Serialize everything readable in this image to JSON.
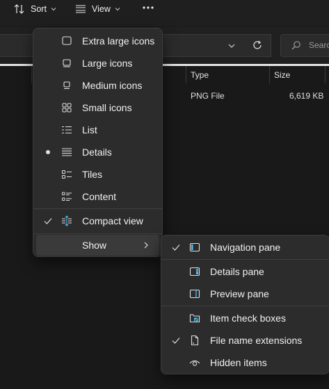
{
  "toolbar": {
    "sort_label": "Sort",
    "view_label": "View"
  },
  "address": {
    "search_placeholder": "Search"
  },
  "columns": [
    {
      "label": ""
    },
    {
      "label": ""
    },
    {
      "label": "Type"
    },
    {
      "label": "Size"
    }
  ],
  "file_row": {
    "type": "PNG File",
    "size": "6,619 KB"
  },
  "view_menu": {
    "items": [
      {
        "label": "Extra large icons",
        "icon": "extra-large-icons-icon"
      },
      {
        "label": "Large icons",
        "icon": "large-icons-icon"
      },
      {
        "label": "Medium icons",
        "icon": "medium-icons-icon"
      },
      {
        "label": "Small icons",
        "icon": "small-icons-icon"
      },
      {
        "label": "List",
        "icon": "list-icon"
      },
      {
        "label": "Details",
        "icon": "details-icon",
        "selected": true
      },
      {
        "label": "Tiles",
        "icon": "tiles-icon"
      },
      {
        "label": "Content",
        "icon": "content-icon"
      }
    ],
    "compact_view": {
      "label": "Compact view",
      "checked": true,
      "icon": "compact-view-icon"
    },
    "show": {
      "label": "Show"
    }
  },
  "show_menu": {
    "items": [
      {
        "label": "Navigation pane",
        "checked": true,
        "icon": "navigation-pane-icon"
      },
      {
        "label": "Details pane",
        "checked": false,
        "icon": "details-pane-icon"
      },
      {
        "label": "Preview pane",
        "checked": false,
        "icon": "preview-pane-icon"
      },
      {
        "label": "Item check boxes",
        "checked": false,
        "icon": "item-check-boxes-icon"
      },
      {
        "label": "File name extensions",
        "checked": true,
        "icon": "file-name-extensions-icon"
      },
      {
        "label": "Hidden items",
        "checked": false,
        "icon": "hidden-items-icon"
      }
    ]
  },
  "colors": {
    "accent": "#4cc2ff",
    "menu_bg": "#2c2c2c",
    "window_bg": "#191919"
  }
}
